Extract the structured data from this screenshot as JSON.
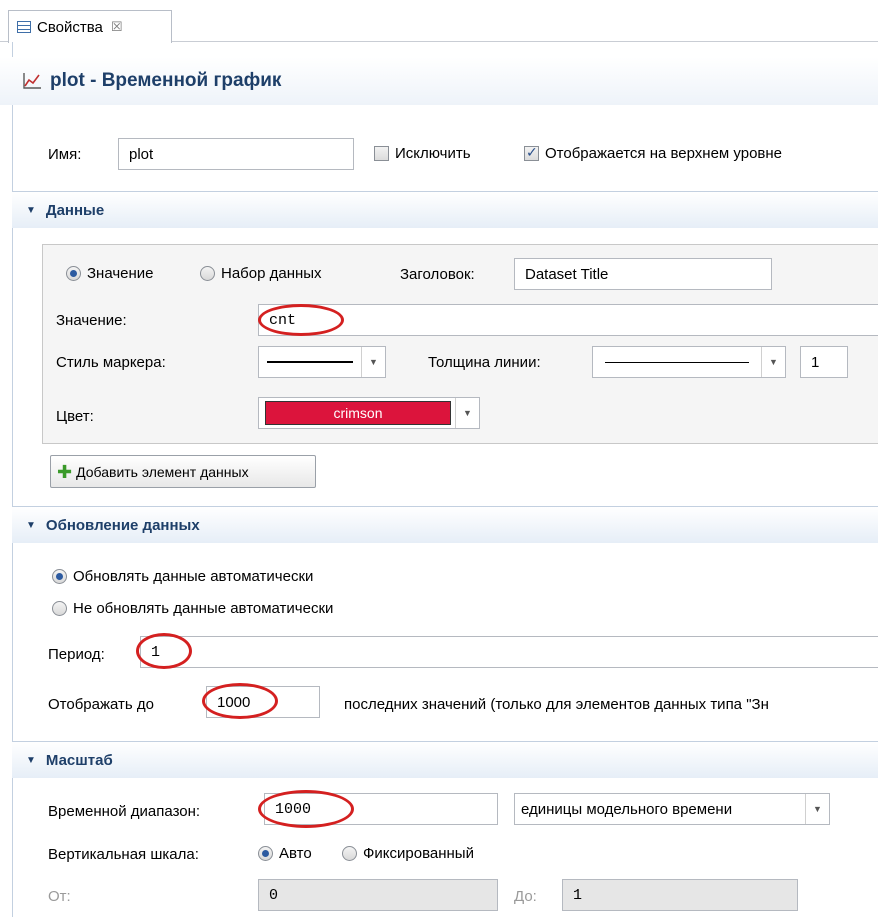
{
  "view_tab": {
    "label": "Свойства",
    "close": "☒"
  },
  "header": {
    "title": "plot - Временной график"
  },
  "general": {
    "name_label": "Имя:",
    "name_value": "plot",
    "exclude_label": "Исключить",
    "exclude_checked": false,
    "top_level_label": "Отображается на верхнем уровне",
    "top_level_checked": true
  },
  "sections": {
    "data": "Данные",
    "update": "Обновление данных",
    "scale": "Масштаб"
  },
  "data_item": {
    "value_option": "Значение",
    "dataset_option": "Набор данных",
    "title_label": "Заголовок:",
    "title_value": "Dataset Title",
    "value_label": "Значение:",
    "value_value": "cnt",
    "marker_style_label": "Стиль маркера:",
    "line_width_label": "Толщина линии:",
    "line_width_value": "1",
    "color_label": "Цвет:",
    "color_value": "crimson",
    "color_hex": "#dc143c"
  },
  "add_button": "Добавить элемент данных",
  "update": {
    "auto_option": "Обновлять данные автоматически",
    "manual_option": "Не обновлять данные автоматически",
    "period_label": "Период:",
    "period_value": "1",
    "show_up_to_label": "Отображать до",
    "show_up_to_value": "1000",
    "show_up_to_suffix": "последних значений (только для элементов данных типа \"Зн"
  },
  "scale": {
    "time_range_label": "Временной диапазон:",
    "time_range_value": "1000",
    "time_units": "единицы модельного времени",
    "vertical_label": "Вертикальная шкала:",
    "auto_option": "Авто",
    "fixed_option": "Фиксированный",
    "from_label": "От:",
    "from_value": "0",
    "to_label": "До:",
    "to_value": "1"
  },
  "colors": {
    "accent": "#1e3f69",
    "annotation": "#d42020"
  }
}
